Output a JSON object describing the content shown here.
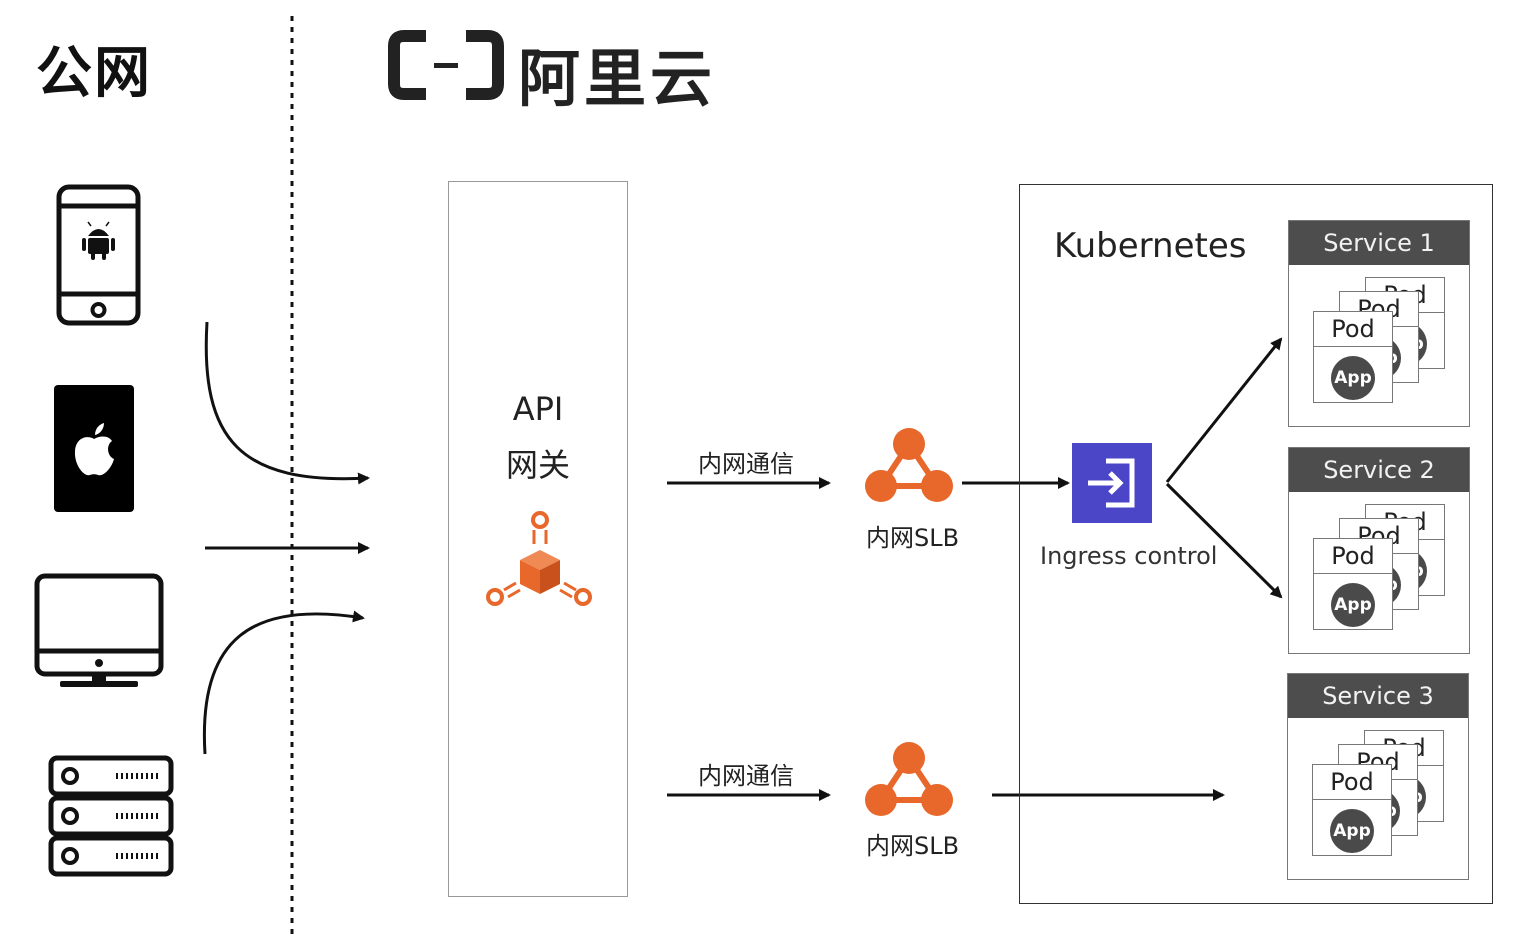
{
  "public_zone": {
    "title": "公网"
  },
  "cloud_zone": {
    "brand": "阿里云",
    "logo_icon": "aliyun-logo-icon"
  },
  "clients": [
    {
      "name": "android-phone",
      "icon": "android-phone-icon"
    },
    {
      "name": "ios-tablet",
      "icon": "apple-tablet-icon"
    },
    {
      "name": "desktop",
      "icon": "desktop-monitor-icon"
    },
    {
      "name": "server",
      "icon": "server-rack-icon"
    }
  ],
  "gateway": {
    "line1": "API",
    "line2": "网关",
    "icon": "api-gateway-icon"
  },
  "edges": {
    "top_label": "内网通信",
    "bottom_label": "内网通信"
  },
  "slb": {
    "top_label": "内网SLB",
    "bottom_label": "内网SLB",
    "icon": "slb-icon"
  },
  "kubernetes": {
    "title": "Kubernetes"
  },
  "ingress": {
    "label": "Ingress control",
    "icon": "ingress-icon"
  },
  "services": [
    {
      "name": "Service 1",
      "pod": "Pod",
      "app": "App"
    },
    {
      "name": "Service 2",
      "pod": "Pod",
      "app": "App"
    },
    {
      "name": "Service 3",
      "pod": "Pod",
      "app": "App"
    }
  ],
  "colors": {
    "accent_orange": "#e8672a",
    "ingress_blue": "#4b46c8",
    "service_header": "#4d4d4d"
  }
}
